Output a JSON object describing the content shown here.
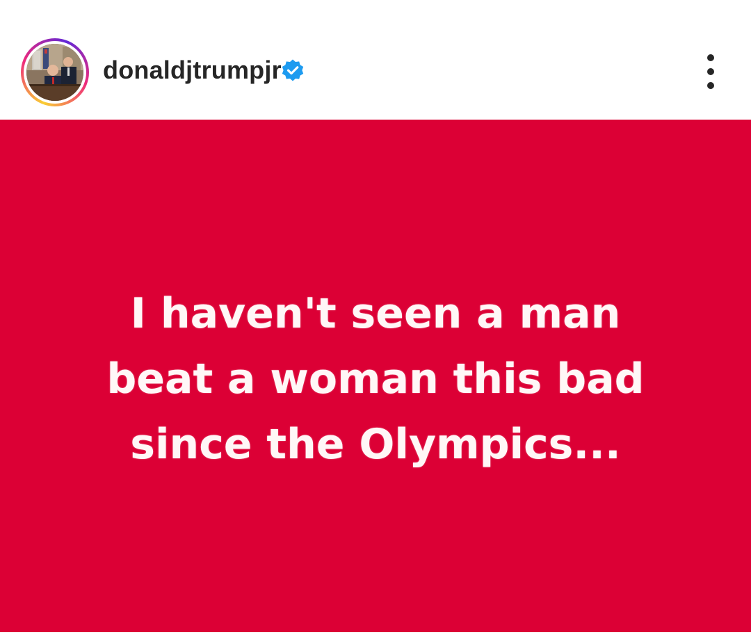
{
  "post": {
    "username": "donaldjtrumpjr",
    "verified": true,
    "avatar_icon": "profile-photo",
    "more_icon": "more-vertical-icon",
    "image": {
      "background_color": "#dc0035",
      "text_color": "#ffffff",
      "lines": [
        "I haven't seen a man",
        "beat a woman this bad",
        "since the Olympics..."
      ]
    }
  }
}
